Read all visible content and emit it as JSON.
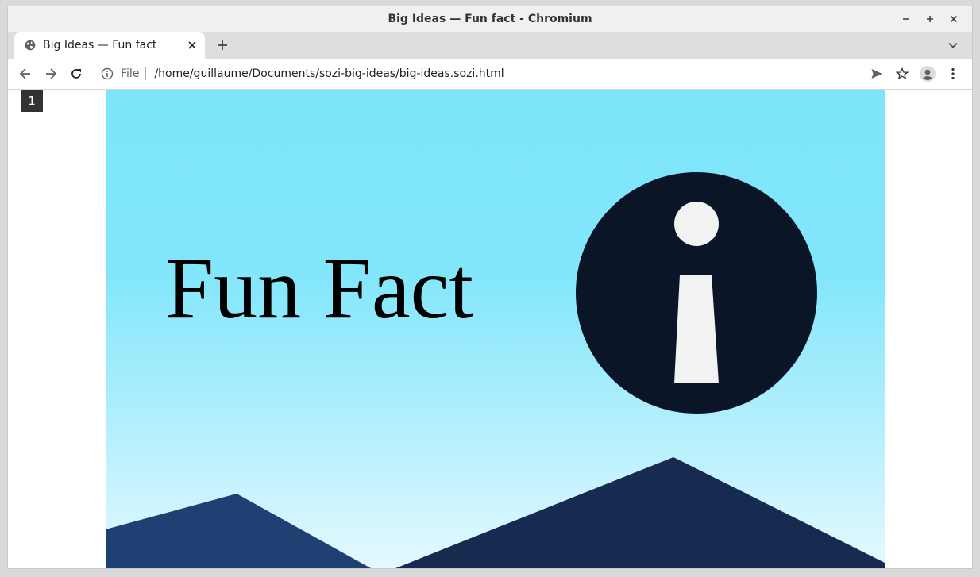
{
  "window": {
    "title": "Big Ideas — Fun fact - Chromium",
    "controls": {
      "minimize": "–",
      "maximize": "+",
      "close": "×"
    }
  },
  "tabs": [
    {
      "title": "Big Ideas — Fun fact",
      "icon": "globe-icon",
      "active": true
    }
  ],
  "tabstrip": {
    "new_tab_label": "+"
  },
  "toolbar": {
    "scheme_label": "File",
    "url": "/home/guillaume/Documents/sozi-big-ideas/big-ideas.sozi.html"
  },
  "slide": {
    "number": "1",
    "title": "Fun Fact"
  },
  "colors": {
    "sky_top": "#7ee5fb",
    "sky_bottom": "#e4f9ff",
    "info_circle": "#0b1528",
    "info_glyph": "#f2f2f2",
    "mountain_left": "#1f4073",
    "mountain_right": "#172a4f",
    "slide_number_bg": "#333333"
  }
}
